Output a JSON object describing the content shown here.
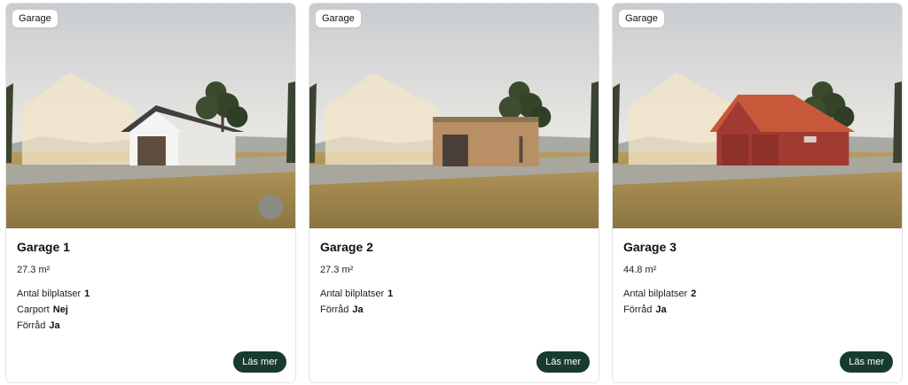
{
  "colors": {
    "button_bg": "#173b30",
    "card_border": "#e3e3e3"
  },
  "cards": [
    {
      "badge": "Garage",
      "title": "Garage 1",
      "area": "27.3 m²",
      "properties": [
        {
          "label": "Antal bilplatser",
          "value": "1"
        },
        {
          "label": "Carport",
          "value": "Nej"
        },
        {
          "label": "Förråd",
          "value": "Ja"
        }
      ],
      "button": "Läs mer"
    },
    {
      "badge": "Garage",
      "title": "Garage 2",
      "area": "27.3 m²",
      "properties": [
        {
          "label": "Antal bilplatser",
          "value": "1"
        },
        {
          "label": "Förråd",
          "value": "Ja"
        }
      ],
      "button": "Läs mer"
    },
    {
      "badge": "Garage",
      "title": "Garage 3",
      "area": "44.8 m²",
      "properties": [
        {
          "label": "Antal bilplatser",
          "value": "2"
        },
        {
          "label": "Förråd",
          "value": "Ja"
        }
      ],
      "button": "Läs mer"
    }
  ]
}
